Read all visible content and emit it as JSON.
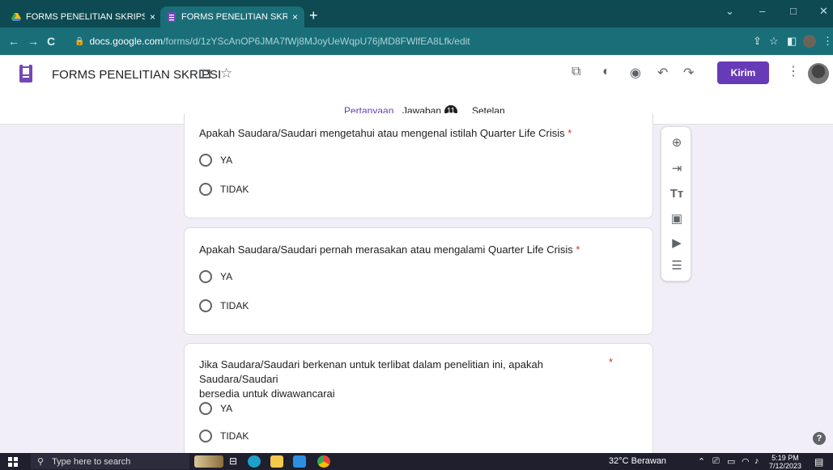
{
  "browser": {
    "tabs": [
      {
        "title": "FORMS PENELITIAN SKRIPSI - Go",
        "close": "×"
      },
      {
        "title": "FORMS PENELITIAN SKRIPSI - Go",
        "close": "×"
      }
    ],
    "new_tab": "+",
    "window_controls": {
      "minimize": "–",
      "maximize": "□",
      "close": "✕",
      "dropdown": "⌄"
    },
    "nav": {
      "back": "←",
      "forward": "→",
      "reload": "C"
    },
    "address": {
      "host": "docs.google.com",
      "path": "/forms/d/1zYScAnOP6JMA7fWj8MJoyUeWqpU76jMD8FWlfEA8Lfk/edit"
    }
  },
  "forms_header": {
    "title": "FORMS PENELITIAN SKRIPSI",
    "send_label": "Kirim",
    "tabs": [
      {
        "label": "Pertanyaan",
        "active": true
      },
      {
        "label": "Jawaban",
        "badge": "11"
      },
      {
        "label": "Setelan"
      }
    ]
  },
  "questions": [
    {
      "text": "Apakah Saudara/Saudari mengetahui atau mengenal istilah Quarter Life Crisis",
      "required": "*",
      "options": [
        "YA",
        "TIDAK"
      ]
    },
    {
      "text": "Apakah Saudara/Saudari pernah merasakan atau mengalami Quarter Life Crisis",
      "required": "*",
      "options": [
        "YA",
        "TIDAK"
      ]
    },
    {
      "text_line1": "Jika Saudara/Saudari berkenan untuk terlibat dalam penelitian ini, apakah Saudara/Saudari",
      "text_line2": "bersedia untuk diwawancarai",
      "required": "*",
      "options": [
        "YA",
        "TIDAK"
      ]
    }
  ],
  "help": "?",
  "taskbar": {
    "search_placeholder": "Type here to search",
    "weather": "32°C  Berawan",
    "time": "5:19 PM",
    "date": "7/12/2023"
  },
  "colors": {
    "accent": "#673ab7",
    "chrome_dark": "#0d4a52",
    "chrome": "#1a6e78",
    "required": "#d93025"
  }
}
